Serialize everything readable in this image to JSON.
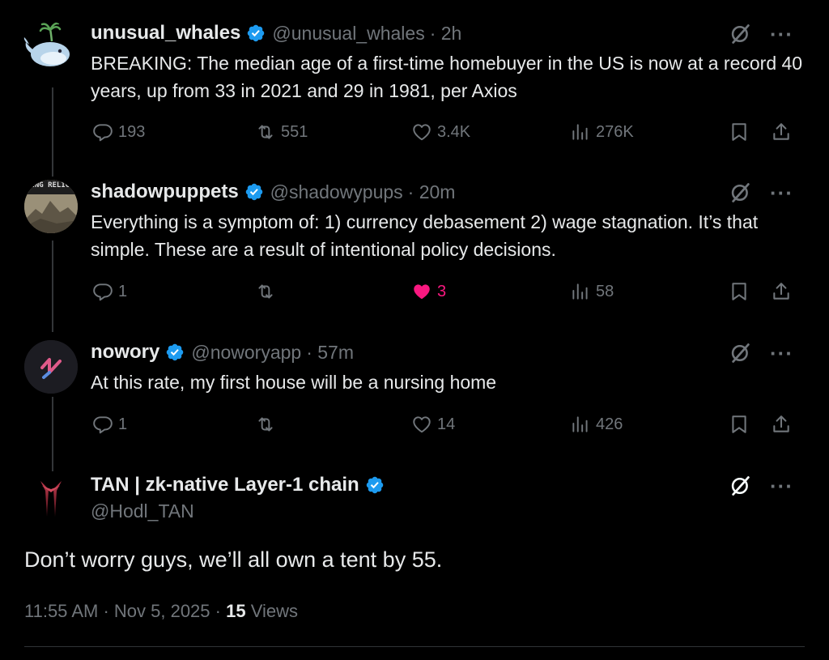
{
  "tweets": [
    {
      "name": "unusual_whales",
      "handle": "@unusual_whales",
      "time": "· 2h",
      "text": "BREAKING: The median age of a first-time homebuyer in the US is now at a record 40 years, up from 33 in 2021 and 29 in 1981, per Axios",
      "replies": "193",
      "retweets": "551",
      "likes": "3.4K",
      "views": "276K"
    },
    {
      "name": "shadowpuppets",
      "handle": "@shadowypups",
      "time": "· 20m",
      "avatar_text": "SING RELIG",
      "text": "Everything is a symptom of: 1) currency debasement 2) wage stagnation. It’s that simple.  These are a result of intentional policy decisions.",
      "replies": "1",
      "retweets": "",
      "likes": "3",
      "views": "58"
    },
    {
      "name": "nowory",
      "handle": "@noworyapp",
      "time": "· 57m",
      "text": "At this rate, my first house will be a nursing home",
      "replies": "1",
      "retweets": "",
      "likes": "14",
      "views": "426"
    }
  ],
  "main": {
    "name": "TAN | zk-native Layer-1 chain",
    "handle": "@Hodl_TAN",
    "text": "Don’t worry guys, we’ll all own a tent by 55.",
    "time": "11:55 AM",
    "date": "· Nov 5, 2025 ·",
    "views_count": "15",
    "views_label": "Views"
  },
  "colors": {
    "verified": "#1d9bf0",
    "like_active": "#f91880",
    "muted": "#71767b",
    "text": "#e7e9ea"
  },
  "icons": [
    "verified-badge-icon",
    "grok-icon",
    "more-icon",
    "reply-icon",
    "retweet-icon",
    "like-icon",
    "views-icon",
    "bookmark-icon",
    "share-icon"
  ]
}
